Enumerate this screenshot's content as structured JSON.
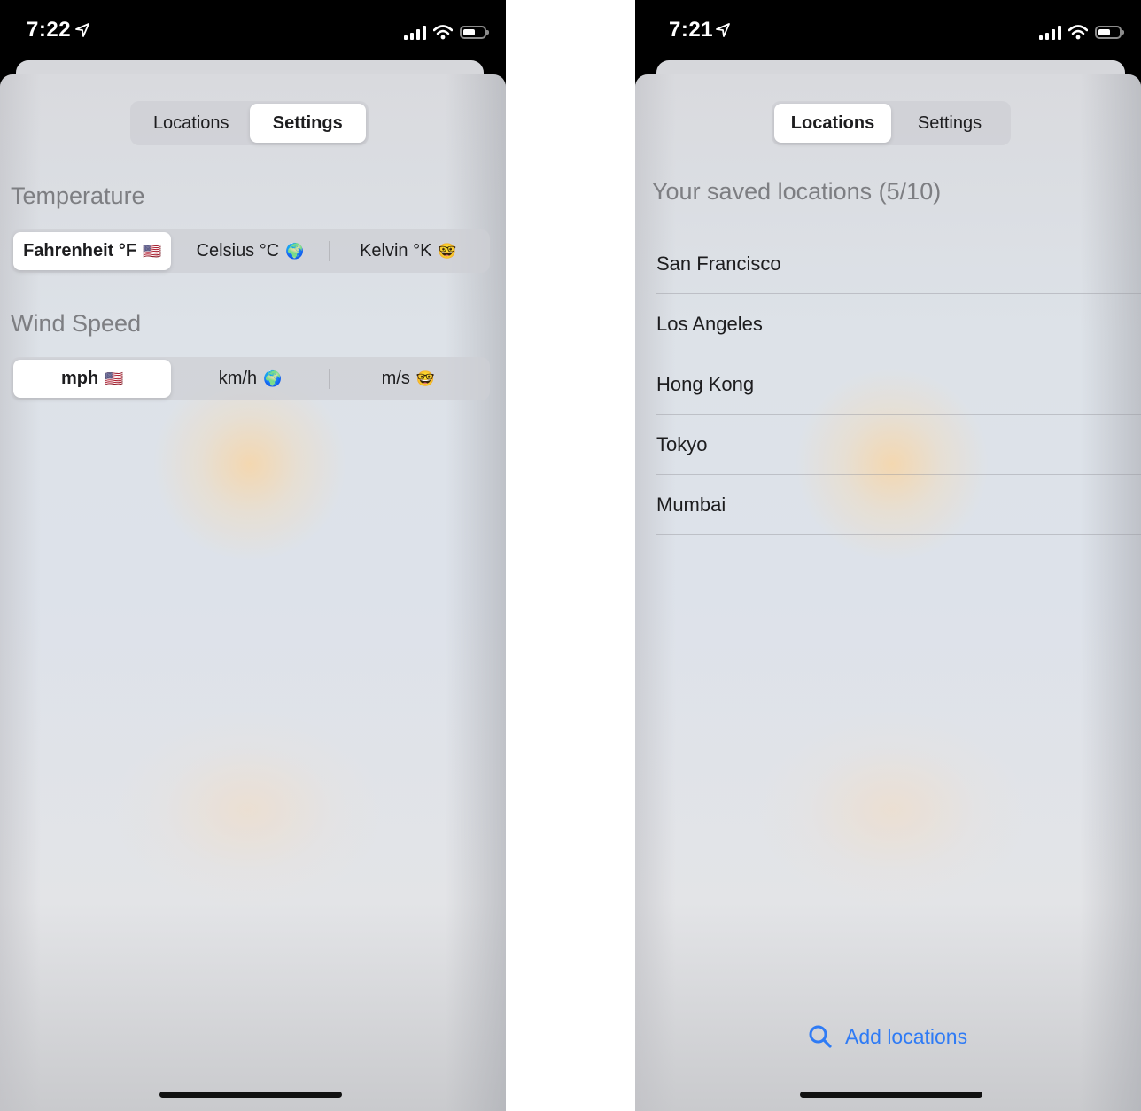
{
  "colors": {
    "accent": "#2f7bf5",
    "background_white": "#ffffff",
    "status_bar": "#000000"
  },
  "left": {
    "status": {
      "time": "7:22"
    },
    "tabs": [
      {
        "label": "Locations",
        "active": false
      },
      {
        "label": "Settings",
        "active": true
      }
    ],
    "temperature": {
      "title": "Temperature",
      "options": [
        {
          "label": "Fahrenheit °F",
          "emoji": "🇺🇸",
          "active": true
        },
        {
          "label": "Celsius °C",
          "emoji": "🌍",
          "active": false
        },
        {
          "label": "Kelvin °K",
          "emoji": "🤓",
          "active": false
        }
      ]
    },
    "wind": {
      "title": "Wind Speed",
      "options": [
        {
          "label": "mph",
          "emoji": "🇺🇸",
          "active": true
        },
        {
          "label": "km/h",
          "emoji": "🌍",
          "active": false
        },
        {
          "label": "m/s",
          "emoji": "🤓",
          "active": false
        }
      ]
    }
  },
  "right": {
    "status": {
      "time": "7:21"
    },
    "tabs": [
      {
        "label": "Locations",
        "active": true
      },
      {
        "label": "Settings",
        "active": false
      }
    ],
    "title": "Your saved locations (5/10)",
    "locations": [
      "San Francisco",
      "Los Angeles",
      "Hong Kong",
      "Tokyo",
      "Mumbai"
    ],
    "add_label": "Add locations",
    "add_icon": "search-icon"
  }
}
